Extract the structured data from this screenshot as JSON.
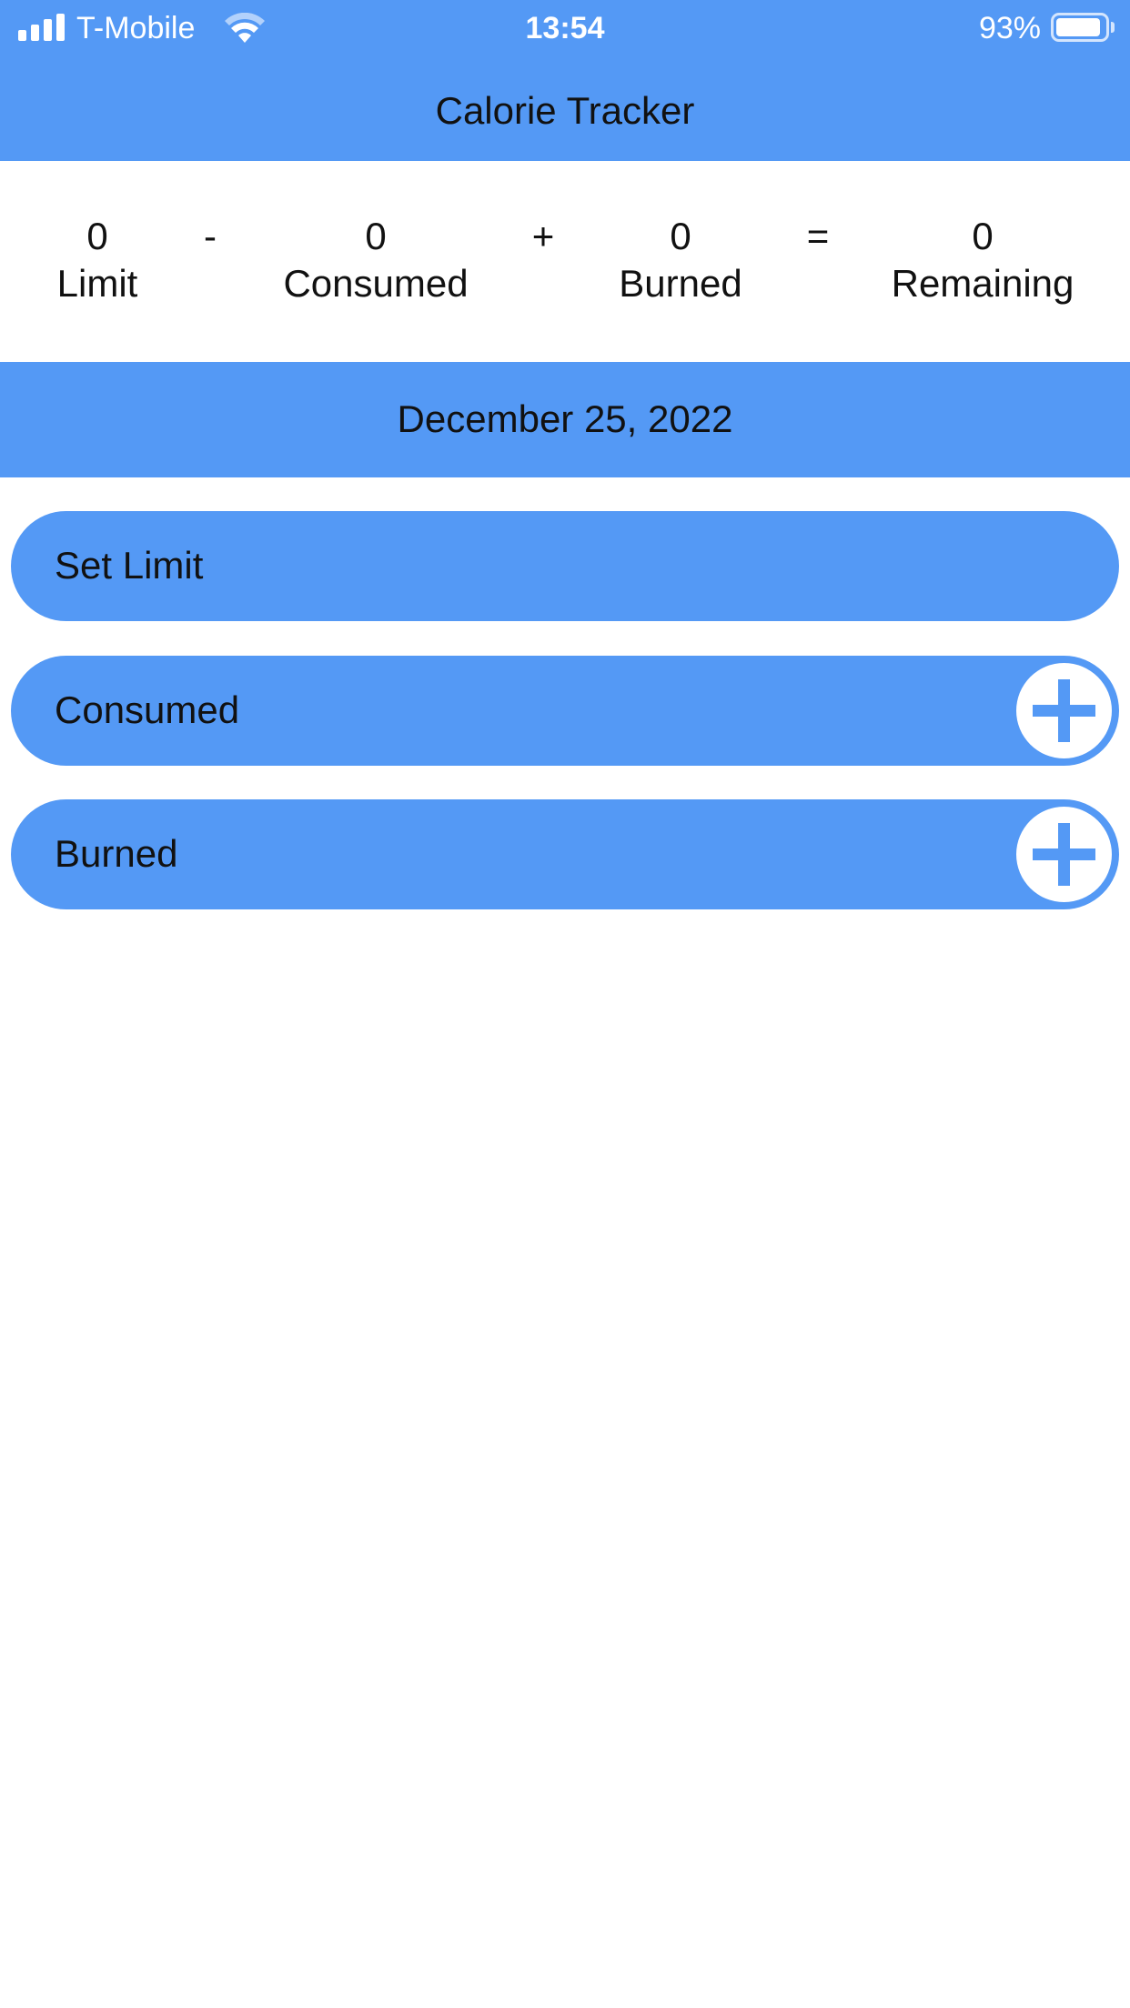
{
  "status_bar": {
    "carrier": "T-Mobile",
    "time": "13:54",
    "battery_percent": "93%",
    "battery_level": 0.93,
    "signal_icon": "signal-bars-icon",
    "wifi_icon": "wifi-icon",
    "battery_icon": "battery-icon"
  },
  "header": {
    "title": "Calorie Tracker"
  },
  "summary": {
    "limit": {
      "value": "0",
      "label": "Limit"
    },
    "minus": "-",
    "consumed": {
      "value": "0",
      "label": "Consumed"
    },
    "plus": "+",
    "burned": {
      "value": "0",
      "label": "Burned"
    },
    "equals": "=",
    "remaining": {
      "value": "0",
      "label": "Remaining"
    }
  },
  "date": "December 25, 2022",
  "actions": {
    "set_limit": "Set Limit",
    "consumed": "Consumed",
    "burned": "Burned",
    "add_icon": "plus-icon"
  },
  "colors": {
    "accent": "#5499F5",
    "background": "#FFFFFF",
    "text": "#111111"
  }
}
